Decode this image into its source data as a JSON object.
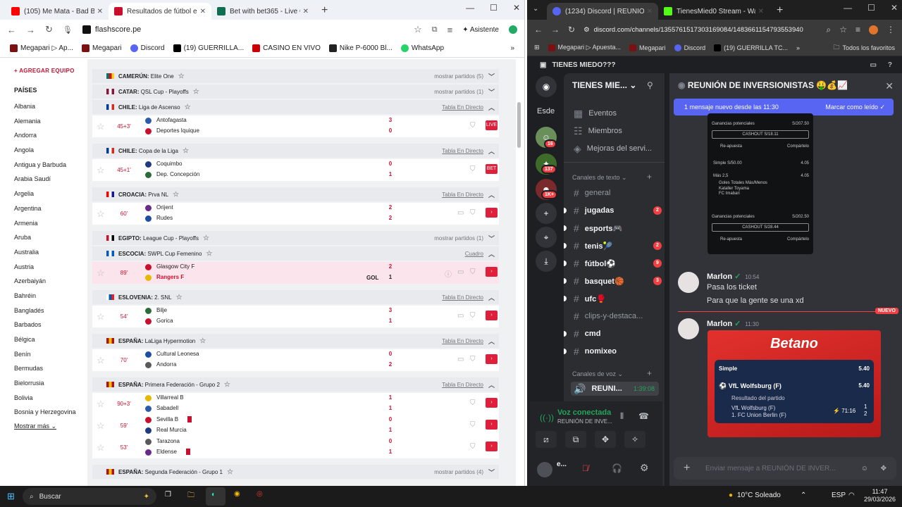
{
  "left_browser": {
    "tabs": [
      {
        "title": "(105) Me Mata - Bad Bunny",
        "active": false
      },
      {
        "title": "Resultados de fútbol en v",
        "active": true
      },
      {
        "title": "Bet with bet365 - Live On",
        "active": false
      }
    ],
    "url": "flashscore.pe",
    "assistant_label": "Asistente",
    "bookmarks": [
      "Megapari ▷ Ap...",
      "Megapari",
      "Discord",
      "(19) GUERRILLA...",
      "CASINO EN VIVO",
      "Nike P-6000 Bl...",
      "WhatsApp"
    ]
  },
  "sidebar": {
    "add_team": "+ AGREGAR EQUIPO",
    "countries_heading": "PAÍSES",
    "countries": [
      "Albania",
      "Alemania",
      "Andorra",
      "Angola",
      "Antigua y Barbuda",
      "Arabia Saudí",
      "Argelia",
      "Argentina",
      "Armenia",
      "Aruba",
      "Australia",
      "Austria",
      "Azerbaiyán",
      "Bahréin",
      "Bangladés",
      "Barbados",
      "Bélgica",
      "Benín",
      "Bermudas",
      "Bielorrusia",
      "Bolivia",
      "Bosnia y Herzegovina"
    ],
    "show_more": "Mostrar más"
  },
  "leagues": [
    {
      "country": "CAMERÚN",
      "name": "Elite One",
      "right": "mostrar partidos (5)",
      "chev": "down",
      "flag": [
        "#007a5e",
        "#ce1126",
        "#fcd116"
      ]
    },
    {
      "country": "CATAR",
      "name": "QSL Cup - Playoffs",
      "right": "mostrar partidos (1)",
      "chev": "down",
      "flag": [
        "#8a1538",
        "#fff",
        "#8a1538"
      ]
    },
    {
      "country": "CHILE",
      "name": "Liga de Ascenso",
      "right": "Tabla En Directo",
      "chev": "up",
      "flag": [
        "#0039a6",
        "#fff",
        "#d52b1e"
      ]
    },
    {
      "country": "CHILE",
      "name": "Copa de la Liga",
      "right": "Tabla En Directo",
      "chev": "up",
      "flag": [
        "#0039a6",
        "#fff",
        "#d52b1e"
      ]
    },
    {
      "country": "CROACIA",
      "name": "Prva NL",
      "right": "Tabla En Directo",
      "chev": "up",
      "flag": [
        "#ff0000",
        "#fff",
        "#171796"
      ]
    },
    {
      "country": "EGIPTO",
      "name": "League Cup - Playoffs",
      "right": "mostrar partidos (1)",
      "chev": "down",
      "flag": [
        "#ce1126",
        "#fff",
        "#000"
      ]
    },
    {
      "country": "ESCOCIA",
      "name": "SWPL Cup Femenino",
      "right": "Cuadro",
      "chev": "up",
      "flag": [
        "#005eb8",
        "#fff",
        "#005eb8"
      ]
    },
    {
      "country": "ESLOVENIA",
      "name": "2. SNL",
      "right": "Tabla En Directo",
      "chev": "up",
      "flag": [
        "#fff",
        "#005da4",
        "#ed1c24"
      ]
    },
    {
      "country": "ESPAÑA",
      "name": "LaLiga Hypermotion",
      "right": "Tabla En Directo",
      "chev": "up",
      "flag": [
        "#aa151b",
        "#f1bf00",
        "#aa151b"
      ]
    },
    {
      "country": "ESPAÑA",
      "name": "Primera Federación - Grupo 2",
      "right": "Tabla En Directo",
      "chev": "up",
      "flag": [
        "#aa151b",
        "#f1bf00",
        "#aa151b"
      ]
    },
    {
      "country": "ESPAÑA",
      "name": "Segunda Federación - Grupo 1",
      "right": "mostrar partidos (4)",
      "chev": "down",
      "flag": [
        "#aa151b",
        "#f1bf00",
        "#aa151b"
      ]
    }
  ],
  "matches": [
    {
      "time": "45+3'",
      "home": "Antofagasta",
      "away": "Deportes Iquique",
      "hs": "3",
      "as": "0",
      "live": "LIVE"
    },
    {
      "time": "45+1'",
      "home": "Coquimbo",
      "away": "Dep. Concepción",
      "hs": "0",
      "as": "1",
      "live": "BET"
    },
    {
      "time": "60'",
      "home": "Orijent",
      "away": "Rudes",
      "hs": "2",
      "as": "2",
      "live": ""
    },
    {
      "time": "89'",
      "home": "Glasgow City F",
      "away": "Rangers F",
      "hs": "2",
      "as": "1",
      "live": "",
      "goal": "GOL"
    },
    {
      "time": "54'",
      "home": "Bilje",
      "away": "Gorica",
      "hs": "3",
      "as": "1",
      "live": ""
    },
    {
      "time": "70'",
      "home": "Cultural Leonesa",
      "away": "Andorra",
      "hs": "0",
      "as": "2",
      "live": ""
    },
    {
      "time": "90+3'",
      "home": "Villarreal B",
      "away": "Sabadell",
      "hs": "1",
      "as": "1",
      "live": ""
    },
    {
      "time": "59'",
      "home": "Sevilla B",
      "away": "Real Murcia",
      "hs": "0",
      "as": "1",
      "live": ""
    },
    {
      "time": "53'",
      "home": "Tarazona",
      "away": "Eldense",
      "hs": "0",
      "as": "1",
      "live": ""
    }
  ],
  "right_browser": {
    "tabs": [
      {
        "title": "(1234) Discord | REUNIÓN",
        "active": true
      },
      {
        "title": "TienesMied0 Stream - Watch L",
        "active": false
      }
    ],
    "url": "discord.com/channels/1355761517303169084/1483661154793553940",
    "bookmarks": [
      "Megapari ▷ Apuesta...",
      "Megapari",
      "Discord",
      "(19) GUERRILLA TC...",
      "Todos los favoritos"
    ]
  },
  "discord": {
    "window_title": "TIENES MIEDO???",
    "server_name": "TIENES MIE...",
    "server_badges": [
      "16",
      "137",
      "1K+"
    ],
    "home_label": "Esde",
    "menu": [
      "Eventos",
      "Miembros",
      "Mejoras del servi..."
    ],
    "text_category": "Canales de texto",
    "channels": [
      {
        "name": "general",
        "bold": false,
        "badge": ""
      },
      {
        "name": "jugadas",
        "bold": true,
        "badge": "2"
      },
      {
        "name": "esports🎮",
        "bold": true,
        "badge": ""
      },
      {
        "name": "tenis🎾",
        "bold": true,
        "badge": "2"
      },
      {
        "name": "fútbol⚽",
        "bold": true,
        "badge": "9"
      },
      {
        "name": "basquet🏀",
        "bold": true,
        "badge": "3"
      },
      {
        "name": "ufc🥊",
        "bold": true,
        "badge": ""
      },
      {
        "name": "clips-y-destaca...",
        "bold": false,
        "badge": ""
      },
      {
        "name": "cmd",
        "bold": true,
        "badge": ""
      },
      {
        "name": "nomixeo",
        "bold": true,
        "badge": ""
      }
    ],
    "voice_category": "Canales de voz",
    "voice_channel": "REUNI...",
    "voice_timer": "1:39:08",
    "voice_status": "Voz conectada",
    "voice_sub": "REUNIÓN DE INVE...",
    "user_short": "e...",
    "chat_title": "REUNIÓN DE INVERSIONISTAS 🤑💰📈",
    "new_msg_banner": "1 mensaje nuevo desde las 11:30",
    "mark_read": "Marcar como leído",
    "messages": [
      {
        "user": "Marlon",
        "time": "10:54",
        "lines": [
          "Pasa los ticket",
          "Para que la gente se una xd"
        ]
      },
      {
        "user": "Marlon",
        "time": "11:30",
        "lines": []
      }
    ],
    "new_label": "NUEVO",
    "ticket": {
      "gain1_label": "Ganancias potenciales",
      "gain1": "S/207.50",
      "cashout1": "CASHOUT S/18.11",
      "share": "Re-apuesta",
      "share2": "Compártelo",
      "simple": "Simple S/50.00",
      "odd": "4.05",
      "pick": "Más 2,5",
      "sub": "Goles Totales Más/Menos",
      "team1": "Kataller Toyama",
      "team2": "FC Imabari",
      "odd2": "4.05",
      "gain2_label": "Ganancias potenciales",
      "gain2": "S/202.50",
      "cashout2": "CASHOUT S/28.44"
    },
    "betano": {
      "brand": "Betano",
      "type": "Simple",
      "total_odd": "5.40",
      "team": "VfL Wolfsburg (F)",
      "odd": "5.40",
      "market": "Resultado del partido",
      "home": "VfL Wolfsburg (F)",
      "away": "1. FC Union Berlin (F)",
      "clock": "71:16",
      "hs": "1",
      "as": "2"
    },
    "input_placeholder": "Enviar mensaje a REUNIÓN DE INVER..."
  },
  "taskbar": {
    "search": "Buscar",
    "weather": "10°C Soleado",
    "lang": "ESP",
    "time": "11:47",
    "date": "29/03/2026"
  },
  "colors": {
    "flashscore_red": "#c8102e",
    "discord_bg": "#313338",
    "blurple": "#5865f2"
  }
}
